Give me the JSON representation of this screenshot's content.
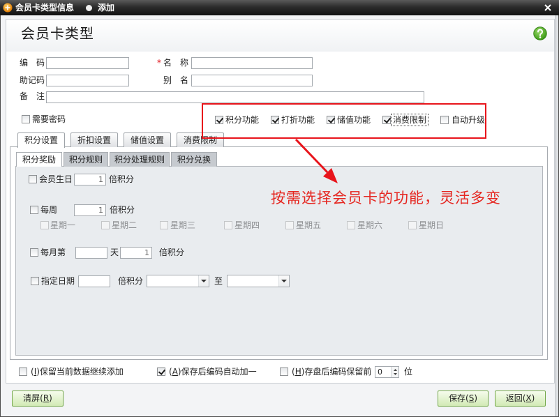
{
  "window": {
    "title": "会员卡类型信息",
    "mode": "添加",
    "app_icon": "app-logo-icon",
    "close_icon": "close-icon"
  },
  "header": {
    "title": "会员卡类型",
    "help_icon": "help-icon"
  },
  "form": {
    "code": {
      "label": "编　码",
      "value": ""
    },
    "name": {
      "required_mark": "*",
      "label": "名　称",
      "value": ""
    },
    "mnemonic": {
      "label": "助记码",
      "value": ""
    },
    "alias": {
      "label": "别　名",
      "value": ""
    },
    "remark": {
      "label": "备　注",
      "value": ""
    },
    "need_password": {
      "label": "需要密码",
      "checked": false
    }
  },
  "features": [
    {
      "label": "积分功能",
      "checked": true
    },
    {
      "label": "打折功能",
      "checked": true
    },
    {
      "label": "储值功能",
      "checked": true
    },
    {
      "label": "消费限制",
      "checked": true,
      "focused": true
    },
    {
      "label": "自动升级",
      "checked": false
    }
  ],
  "tabs": [
    {
      "label": "积分设置",
      "active": true
    },
    {
      "label": "折扣设置",
      "active": false
    },
    {
      "label": "储值设置",
      "active": false
    },
    {
      "label": "消费限制",
      "active": false
    }
  ],
  "subtabs": [
    {
      "label": "积分奖励",
      "active": true
    },
    {
      "label": "积分规则",
      "active": false
    },
    {
      "label": "积分处理规则",
      "active": false
    },
    {
      "label": "积分兑换",
      "active": false
    }
  ],
  "points_reward": {
    "birthday": {
      "label": "会员生日",
      "checked": false,
      "multiplier": "1",
      "unit": "倍积分"
    },
    "weekly": {
      "label": "每周",
      "checked": false,
      "multiplier": "1",
      "unit": "倍积分",
      "weekdays_disabled": true,
      "weekdays": [
        {
          "label": "星期一",
          "checked": false
        },
        {
          "label": "星期二",
          "checked": false
        },
        {
          "label": "星期三",
          "checked": false
        },
        {
          "label": "星期四",
          "checked": false
        },
        {
          "label": "星期五",
          "checked": false
        },
        {
          "label": "星期六",
          "checked": false
        },
        {
          "label": "星期日",
          "checked": false
        }
      ]
    },
    "monthly": {
      "label": "每月第",
      "checked": false,
      "day": "",
      "day_unit": "天",
      "multiplier": "1",
      "unit": "倍积分"
    },
    "date_range": {
      "label": "指定日期",
      "checked": false,
      "multiplier": "",
      "unit": "倍积分",
      "from": "",
      "to_label": "至",
      "to": ""
    }
  },
  "annotation": {
    "text": "按需选择会员卡的功能，灵活多变"
  },
  "footer": {
    "keep_data": {
      "label": "(I)保留当前数据继续添加",
      "checked": false
    },
    "auto_increment": {
      "label": "(A)保存后编码自动加一",
      "checked": true
    },
    "keep_prefix": {
      "label": "(H)存盘后编码保留前",
      "checked": false,
      "digits": "0",
      "unit": "位"
    }
  },
  "buttons": {
    "clear": "清屏(R)",
    "save": "保存(S)",
    "back": "返回(X)"
  },
  "colors": {
    "highlight_box": "#e8141b",
    "annotation": "#e52620",
    "button_border": "#74a84a",
    "help_icon": "#4fae22"
  }
}
